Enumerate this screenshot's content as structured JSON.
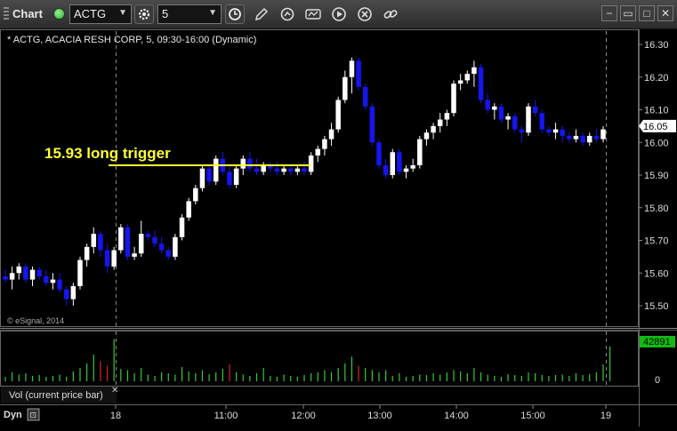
{
  "toolbar": {
    "title": "Chart",
    "symbol": "ACTG",
    "interval": "5",
    "colors": {
      "bg": "#3a3a3a",
      "field": "#141414"
    }
  },
  "chart_data": {
    "type": "candlestick",
    "header": "* ACTG, ACACIA RESH CORP, 5, 09:30-16:00 (Dynamic)",
    "watermark": "© eSignal, 2014",
    "annotation": {
      "text": "15.93 long trigger",
      "level": 15.93,
      "color": "#ffff33"
    },
    "last_price": "16.05",
    "price_ticks": [
      "15.50",
      "15.60",
      "15.70",
      "15.80",
      "15.90",
      "16.00",
      "16.10",
      "16.20",
      "16.30"
    ],
    "y_range": [
      15.45,
      16.34
    ],
    "time_ticks": [
      "18",
      "11:00",
      "12:00",
      "13:00",
      "14:00",
      "15:00",
      "19"
    ],
    "volume_panel": {
      "label": "Vol (current price bar)",
      "last_value": "42891",
      "zero_label": "0",
      "volume_color": "#33cc33",
      "volume_down_color": "#dd2222"
    },
    "bottom_label": "Dyn",
    "colors": {
      "up": "#ffffff",
      "down": "#1515ee",
      "grid": "#777777",
      "text": "#dddddd"
    },
    "candles": [
      [
        15.59,
        15.61,
        15.57,
        15.58
      ],
      [
        15.58,
        15.62,
        15.55,
        15.6
      ],
      [
        15.6,
        15.63,
        15.58,
        15.62
      ],
      [
        15.62,
        15.63,
        15.57,
        15.58
      ],
      [
        15.58,
        15.62,
        15.56,
        15.61
      ],
      [
        15.61,
        15.62,
        15.58,
        15.59
      ],
      [
        15.59,
        15.61,
        15.56,
        15.57
      ],
      [
        15.57,
        15.6,
        15.55,
        15.58
      ],
      [
        15.58,
        15.6,
        15.54,
        15.55
      ],
      [
        15.55,
        15.56,
        15.5,
        15.52
      ],
      [
        15.52,
        15.57,
        15.5,
        15.56
      ],
      [
        15.56,
        15.65,
        15.55,
        15.64
      ],
      [
        15.64,
        15.69,
        15.62,
        15.68
      ],
      [
        15.68,
        15.74,
        15.66,
        15.72
      ],
      [
        15.72,
        15.73,
        15.65,
        15.67
      ],
      [
        15.67,
        15.69,
        15.6,
        15.62
      ],
      [
        15.62,
        15.68,
        15.61,
        15.67
      ],
      [
        15.67,
        15.75,
        15.66,
        15.74
      ],
      [
        15.74,
        15.75,
        15.64,
        15.65
      ],
      [
        15.65,
        15.68,
        15.64,
        15.66
      ],
      [
        15.66,
        15.76,
        15.65,
        15.72
      ],
      [
        15.72,
        15.73,
        15.7,
        15.71
      ],
      [
        15.71,
        15.73,
        15.68,
        15.69
      ],
      [
        15.69,
        15.71,
        15.66,
        15.67
      ],
      [
        15.67,
        15.68,
        15.64,
        15.65
      ],
      [
        15.65,
        15.72,
        15.64,
        15.71
      ],
      [
        15.71,
        15.78,
        15.7,
        15.77
      ],
      [
        15.77,
        15.83,
        15.76,
        15.82
      ],
      [
        15.82,
        15.87,
        15.81,
        15.86
      ],
      [
        15.86,
        15.93,
        15.85,
        15.92
      ],
      [
        15.92,
        15.93,
        15.87,
        15.88
      ],
      [
        15.88,
        15.96,
        15.87,
        15.95
      ],
      [
        15.95,
        15.97,
        15.9,
        15.91
      ],
      [
        15.91,
        15.93,
        15.86,
        15.87
      ],
      [
        15.87,
        15.93,
        15.86,
        15.92
      ],
      [
        15.92,
        15.96,
        15.9,
        15.95
      ],
      [
        15.95,
        15.97,
        15.91,
        15.92
      ],
      [
        15.92,
        15.95,
        15.9,
        15.91
      ],
      [
        15.91,
        15.94,
        15.9,
        15.93
      ],
      [
        15.93,
        15.94,
        15.91,
        15.92
      ],
      [
        15.92,
        15.94,
        15.9,
        15.91
      ],
      [
        15.91,
        15.93,
        15.9,
        15.92
      ],
      [
        15.92,
        15.93,
        15.9,
        15.91
      ],
      [
        15.91,
        15.93,
        15.9,
        15.92
      ],
      [
        15.92,
        15.94,
        15.9,
        15.91
      ],
      [
        15.91,
        15.97,
        15.9,
        15.96
      ],
      [
        15.96,
        15.99,
        15.94,
        15.98
      ],
      [
        15.98,
        16.02,
        15.96,
        16.01
      ],
      [
        16.01,
        16.06,
        15.99,
        16.04
      ],
      [
        16.04,
        16.14,
        16.03,
        16.13
      ],
      [
        16.13,
        16.22,
        16.12,
        16.2
      ],
      [
        16.2,
        16.26,
        16.15,
        16.25
      ],
      [
        16.25,
        16.26,
        16.16,
        16.17
      ],
      [
        16.17,
        16.18,
        16.1,
        16.11
      ],
      [
        16.11,
        16.12,
        15.99,
        16.0
      ],
      [
        16.0,
        16.01,
        15.92,
        15.93
      ],
      [
        15.93,
        15.95,
        15.89,
        15.9
      ],
      [
        15.9,
        15.98,
        15.89,
        15.97
      ],
      [
        15.97,
        15.98,
        15.9,
        15.91
      ],
      [
        15.91,
        15.93,
        15.89,
        15.92
      ],
      [
        15.92,
        15.95,
        15.91,
        15.93
      ],
      [
        15.93,
        16.02,
        15.92,
        16.01
      ],
      [
        16.01,
        16.04,
        15.99,
        16.03
      ],
      [
        16.03,
        16.06,
        16.01,
        16.05
      ],
      [
        16.05,
        16.09,
        16.03,
        16.07
      ],
      [
        16.07,
        16.1,
        16.05,
        16.09
      ],
      [
        16.09,
        16.19,
        16.08,
        16.18
      ],
      [
        16.18,
        16.21,
        16.16,
        16.19
      ],
      [
        16.19,
        16.22,
        16.18,
        16.21
      ],
      [
        16.21,
        16.25,
        16.17,
        16.23
      ],
      [
        16.23,
        16.24,
        16.12,
        16.13
      ],
      [
        16.13,
        16.15,
        16.09,
        16.1
      ],
      [
        16.1,
        16.12,
        16.07,
        16.11
      ],
      [
        16.11,
        16.12,
        16.06,
        16.07
      ],
      [
        16.07,
        16.09,
        16.04,
        16.08
      ],
      [
        16.08,
        16.09,
        16.03,
        16.04
      ],
      [
        16.04,
        16.05,
        16.0,
        16.03
      ],
      [
        16.03,
        16.12,
        16.02,
        16.11
      ],
      [
        16.11,
        16.13,
        16.08,
        16.09
      ],
      [
        16.09,
        16.1,
        16.03,
        16.04
      ],
      [
        16.04,
        16.05,
        16.02,
        16.03
      ],
      [
        16.03,
        16.06,
        16.01,
        16.04
      ],
      [
        16.04,
        16.05,
        16.0,
        16.02
      ],
      [
        16.02,
        16.03,
        16.0,
        16.01
      ],
      [
        16.01,
        16.04,
        16.0,
        16.02
      ],
      [
        16.02,
        16.03,
        15.99,
        16.0
      ],
      [
        16.0,
        16.03,
        15.99,
        16.02
      ],
      [
        16.02,
        16.04,
        16.0,
        16.01
      ],
      [
        16.01,
        16.05,
        16.0,
        16.04
      ]
    ],
    "volume": [
      0.1,
      0.2,
      0.15,
      0.18,
      0.12,
      0.14,
      0.1,
      0.12,
      0.15,
      0.1,
      0.22,
      0.3,
      0.4,
      0.6,
      0.45,
      0.35,
      0.95,
      0.28,
      0.25,
      0.18,
      0.3,
      0.15,
      0.12,
      0.2,
      0.18,
      0.15,
      0.32,
      0.22,
      0.18,
      0.25,
      0.16,
      0.2,
      0.28,
      0.38,
      0.2,
      0.15,
      0.12,
      0.18,
      0.3,
      0.12,
      0.1,
      0.15,
      0.12,
      0.1,
      0.14,
      0.18,
      0.2,
      0.25,
      0.2,
      0.3,
      0.4,
      0.55,
      0.35,
      0.3,
      0.25,
      0.2,
      0.25,
      0.12,
      0.18,
      0.1,
      0.12,
      0.15,
      0.14,
      0.18,
      0.15,
      0.2,
      0.25,
      0.22,
      0.18,
      0.3,
      0.2,
      0.15,
      0.12,
      0.1,
      0.16,
      0.14,
      0.12,
      0.2,
      0.18,
      0.14,
      0.12,
      0.14,
      0.15,
      0.12,
      0.18,
      0.14,
      0.16,
      0.2,
      0.38,
      0.78
    ]
  }
}
